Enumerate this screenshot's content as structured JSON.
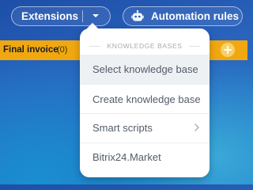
{
  "toolbar": {
    "extensions_label": "Extensions",
    "automation_label": "Automation rules"
  },
  "stage": {
    "title": "Final invoice",
    "count": "(0)",
    "color": "#f1a810"
  },
  "menu": {
    "header": "KNOWLEDGE BASES",
    "items": [
      {
        "label": "Select knowledge base",
        "highlighted": true
      },
      {
        "label": "Create knowledge base"
      },
      {
        "label": "Smart scripts",
        "has_submenu": true
      },
      {
        "label": "Bitrix24.Market"
      }
    ]
  },
  "icons": {
    "extensions_dropdown": "chevron-down-icon",
    "automation": "robot-icon",
    "add_deal": "plus-icon",
    "submenu": "chevron-right-icon"
  }
}
